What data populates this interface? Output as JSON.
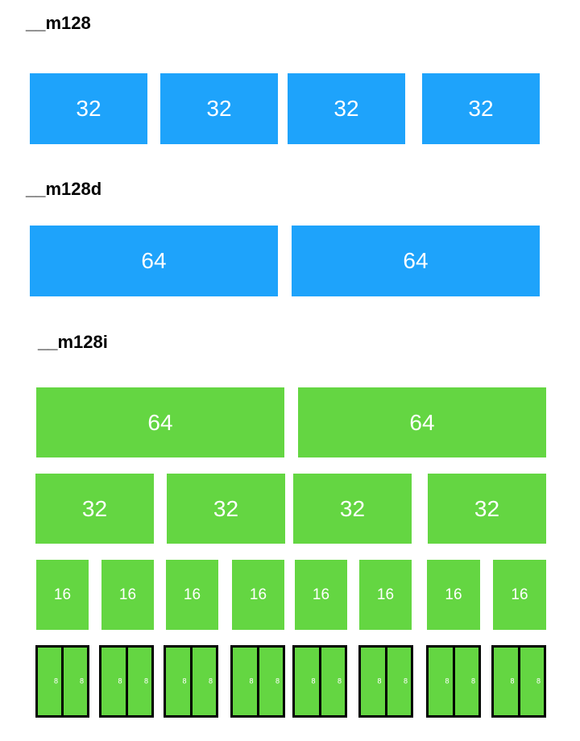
{
  "colors": {
    "float_lane": "#1ea3fb",
    "int_lane": "#64d642",
    "text": "#ffffff",
    "border": "#000000"
  },
  "m128": {
    "title": "__m128",
    "lanes": [
      "32",
      "32",
      "32",
      "32"
    ]
  },
  "m128d": {
    "title": "__m128d",
    "lanes": [
      "64",
      "64"
    ]
  },
  "m128i": {
    "title": "__m128i",
    "lanes64": [
      "64",
      "64"
    ],
    "lanes32": [
      "32",
      "32",
      "32",
      "32"
    ],
    "lanes16": [
      "16",
      "16",
      "16",
      "16",
      "16",
      "16",
      "16",
      "16"
    ],
    "lanes8": [
      "8",
      "8",
      "8",
      "8",
      "8",
      "8",
      "8",
      "8",
      "8",
      "8",
      "8",
      "8",
      "8",
      "8",
      "8",
      "8"
    ]
  }
}
